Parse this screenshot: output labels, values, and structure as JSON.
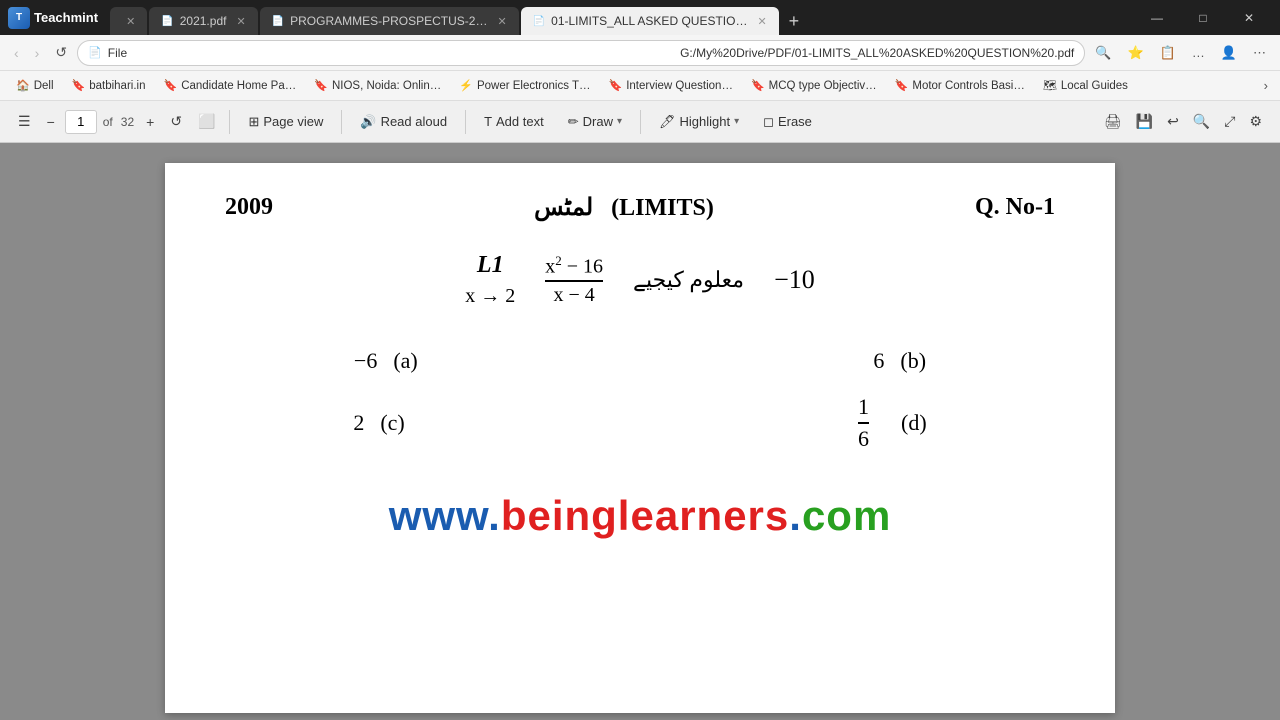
{
  "titlebar": {
    "logo_text": "Teachmint",
    "tabs": [
      {
        "id": "newtab",
        "label": "",
        "icon": "",
        "active": false,
        "closable": true
      },
      {
        "id": "2021pdf",
        "label": "2021.pdf",
        "icon": "📄",
        "active": false,
        "closable": true
      },
      {
        "id": "prospectus",
        "label": "PROGRAMMES-PROSPECTUS-2…",
        "icon": "📄",
        "active": false,
        "closable": true
      },
      {
        "id": "limits",
        "label": "01-LIMITS_ALL ASKED QUESTIO…",
        "icon": "📄",
        "active": true,
        "closable": true
      }
    ],
    "window_controls": {
      "minimize": "—",
      "maximize": "□",
      "close": "✕"
    }
  },
  "address_bar": {
    "back": "‹",
    "forward": "›",
    "reload": "↺",
    "file_label": "File",
    "url": "G:/My%20Drive/PDF/01-LIMITS_ALL%20ASKED%20QUESTION%20.pdf"
  },
  "bookmarks": {
    "items": [
      {
        "label": "Dell",
        "icon": "🏠"
      },
      {
        "label": "batbihari.in",
        "icon": "🔖"
      },
      {
        "label": "Candidate Home Pa…",
        "icon": "🔖"
      },
      {
        "label": "NIOS, Noida: Onlin…",
        "icon": "🔖"
      },
      {
        "label": "Power Electronics T…",
        "icon": "⚡"
      },
      {
        "label": "Interview Question…",
        "icon": "🔖"
      },
      {
        "label": "MCQ type Objectiv…",
        "icon": "🔖"
      },
      {
        "label": "Motor Controls Basi…",
        "icon": "🔖"
      },
      {
        "label": "Local Guides",
        "icon": "🗺"
      }
    ]
  },
  "pdf_toolbar": {
    "page_current": "1",
    "page_total": "32",
    "page_view_label": "Page view",
    "read_aloud_label": "Read aloud",
    "add_text_label": "Add text",
    "draw_label": "Draw",
    "highlight_label": "Highlight",
    "erase_label": "Erase"
  },
  "pdf_content": {
    "year": "2009",
    "urdu_title": "لمٹس",
    "english_title": "(LIMITS)",
    "question_no": "Q. No-1",
    "l1_label": "L1",
    "fraction_num": "x² − 16",
    "fraction_den": "x − 4",
    "x_arrow": "x → 2",
    "urdu_maloom": "معلوم کیجیے",
    "value_neg10": "−10",
    "option_a_label": "(a)",
    "option_a_value": "−6",
    "option_b_label": "(b)",
    "option_b_value": "6",
    "option_c_label": "(c)",
    "option_c_value": "2",
    "option_d_label": "(d)",
    "option_d_num": "1",
    "option_d_den": "6",
    "watermark_part1": "www.",
    "watermark_part2": "beinglearners",
    "watermark_part3": "."
  }
}
